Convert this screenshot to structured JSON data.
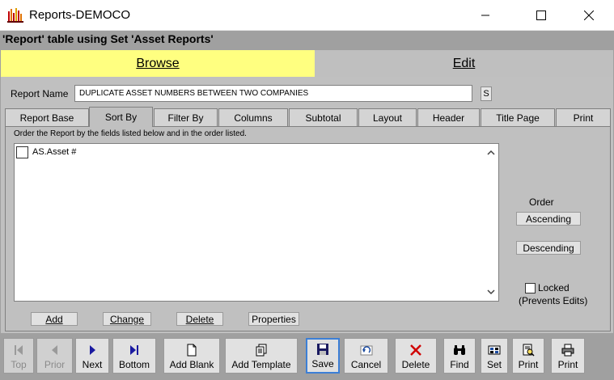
{
  "window": {
    "title": "Reports-DEMOCO",
    "minimize_icon": "minimize-icon",
    "maximize_icon": "maximize-icon",
    "close_icon": "close-icon"
  },
  "caption": "'Report' table using Set 'Asset Reports'",
  "modes": {
    "browse": "Browse",
    "edit": "Edit"
  },
  "report": {
    "label": "Report Name",
    "name": "DUPLICATE ASSET NUMBERS BETWEEN TWO COMPANIES",
    "s_button": "S"
  },
  "tabs": [
    {
      "label": "Report Base"
    },
    {
      "label": "Sort By"
    },
    {
      "label": "Filter By"
    },
    {
      "label": "Columns"
    },
    {
      "label": "Subtotal"
    },
    {
      "label": "Layout"
    },
    {
      "label": "Header"
    },
    {
      "label": "Title Page"
    },
    {
      "label": "Print"
    }
  ],
  "active_tab": "Sort By",
  "sortby": {
    "instructions": "Order the Report by the fields listed below and in the order listed.",
    "items": [
      {
        "label": "AS.Asset #",
        "checked": false
      }
    ],
    "buttons": {
      "add": "Add",
      "change": "Change",
      "delete": "Delete",
      "properties": "Properties"
    },
    "order_label": "Order",
    "ascending": "Ascending",
    "descending": "Descending",
    "locked": "Locked",
    "locked_sub": "(Prevents Edits)"
  },
  "toolbar": {
    "top": "Top",
    "prior": "Prior",
    "next": "Next",
    "bottom": "Bottom",
    "add_blank": "Add Blank",
    "add_template": "Add Template",
    "save": "Save",
    "cancel": "Cancel",
    "delete": "Delete",
    "find": "Find",
    "set": "Set",
    "print": "Print",
    "print2": "Print"
  },
  "colors": {
    "browse_bg": "#ffff80",
    "panel_bg": "#c0c0c0",
    "frame_bg": "#a0a0a0",
    "save_border": "#3c7fd6",
    "delete_icon": "#d00000",
    "nav_icon": "#1a1aa0"
  }
}
